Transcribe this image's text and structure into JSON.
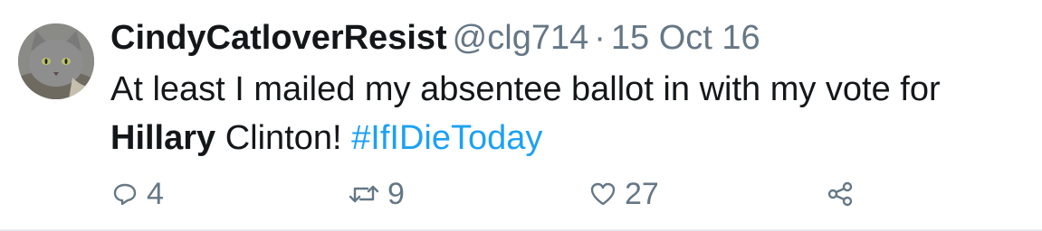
{
  "tweet": {
    "display_name": "CindyCatloverResist",
    "handle": "@clg714",
    "separator": "·",
    "date": "15 Oct 16",
    "text_part1": "At least I mailed my absentee ballot in with my vote for ",
    "text_bold": "Hillary",
    "text_part2": " Clinton! ",
    "hashtag": "#IfIDieToday",
    "colors": {
      "text": "#14171a",
      "secondary": "#657786",
      "link": "#1da1f2",
      "divider": "#e6ecf0"
    }
  },
  "actions": {
    "reply": {
      "icon": "reply-icon",
      "count": "4"
    },
    "retweet": {
      "icon": "retweet-icon",
      "count": "9"
    },
    "like": {
      "icon": "heart-icon",
      "count": "27"
    },
    "share": {
      "icon": "share-icon"
    }
  }
}
